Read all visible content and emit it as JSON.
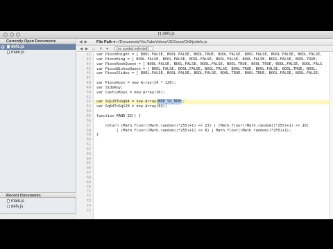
{
  "window": {
    "title": "defs.js"
  },
  "sidebar": {
    "open_header": "Currently Open Documents",
    "open_docs": [
      {
        "label": "defs.js",
        "selected": true
      },
      {
        "label": "main.js",
        "selected": false
      }
    ],
    "recent_header": "Recent Documents",
    "recent_docs": [
      {
        "label": "main.js"
      },
      {
        "label": "defs.js"
      }
    ]
  },
  "toolbar": {
    "path_label": "File Path ▾ :",
    "path": "~/Documents/YouTubeVideos/JSChess/Ch9/js/defs.js"
  },
  "subbar": {
    "symbol_select": "(no symbol selected)"
  },
  "editor": {
    "line_numbers": [
      "42",
      "43",
      "44",
      "45",
      "46",
      "47",
      "48",
      "49",
      "50",
      "51",
      "52",
      "53",
      "54",
      "55",
      "56",
      "57",
      "58",
      "59",
      "60",
      "61",
      "62",
      "63",
      "64",
      "65",
      "66",
      "67",
      "68",
      "69",
      "70",
      "71",
      "72",
      "73",
      "74",
      "75"
    ],
    "lines": [
      "var PieceKnight = [ BOOL.FALSE, BOOL.FALSE, BOOL.TRUE, BOOL.FALSE, BOOL.FALSE, BOOL.FALSE, BOOL.FALSE,",
      "var PieceKing = [ BOOL.FALSE, BOOL.FALSE, BOOL.FALSE, BOOL.FALSE, BOOL.FALSE, BOOL.FALSE, BOOL.TRUE,",
      "var PieceRookQueen = [ BOOL.FALSE, BOOL.FALSE, BOOL.FALSE, BOOL.TRUE, BOOL.TRUE, BOOL.FALSE, BOOL.FALS",
      "var PieceBishopQueen = [ BOOL.FALSE, BOOL.FALSE, BOOL.FALSE, BOOL.TRUE, BOOL.FALSE, BOOL.TRUE, BOOL.",
      "var PieceSlides = [ BOOL.FALSE, BOOL.FALSE, BOOL.FALSE, BOOL.TRUE, BOOL.TRUE, BOOL.FALSE, BOOL.FALSE,",
      "",
      "var PieceKeys = new Array(14 * 120);",
      "var SideKey;",
      "var CastleKeys = new Array(16);",
      "",
      "var Sq120ToSq64 = new Array(BRD_SQ_NUM);",
      "var Sq64ToSq120 = new Array(64);",
      "",
      "function RAND_32() {",
      "",
      "    return (Math.floor((Math.random()*255)+1) << 23) | (Math.floor((Math.random()*255)+1) << 16)",
      "         | (Math.floor((Math.random()*255)+1) << 8) | Math.floor((Math.random()*255)+1);",
      "}",
      "",
      "",
      "",
      "",
      "",
      "",
      "",
      "",
      "",
      "",
      "",
      "",
      "",
      "",
      "",
      ""
    ],
    "highlighted_token": "BRD_SQ_NUM"
  }
}
